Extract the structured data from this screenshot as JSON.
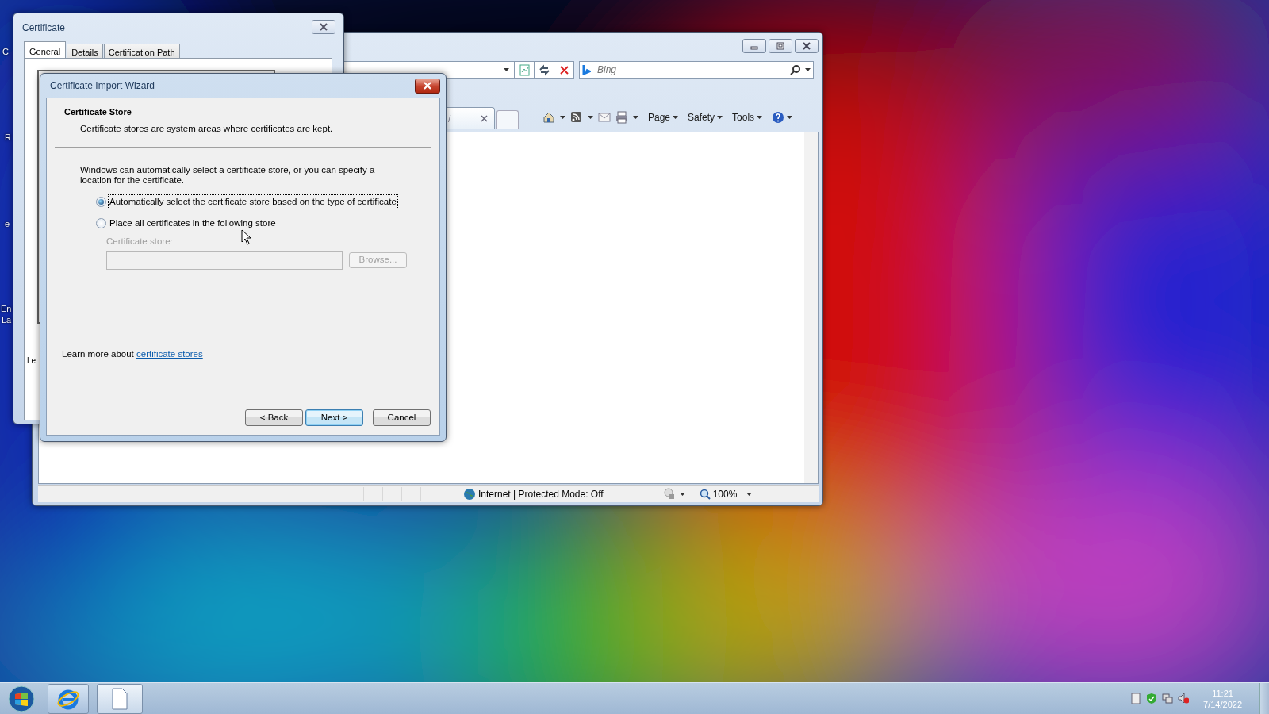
{
  "desktop": {
    "icon_labels": [
      {
        "text": "C"
      },
      {
        "text": "R"
      },
      {
        "text": "e"
      },
      {
        "text": "En"
      },
      {
        "text": "La"
      }
    ]
  },
  "browser": {
    "search": {
      "placeholder": "Bing"
    },
    "tab": {
      "title": "/"
    },
    "menus": [
      {
        "label": "Page"
      },
      {
        "label": "Safety"
      },
      {
        "label": "Tools"
      }
    ],
    "status": {
      "zone": "Internet | Protected Mode: Off",
      "zoom": "100%"
    }
  },
  "certificate_window": {
    "title": "Certificate",
    "tabs": [
      {
        "label": "General",
        "selected": true
      },
      {
        "label": "Details",
        "selected": false
      },
      {
        "label": "Certification Path",
        "selected": false
      }
    ],
    "panel_text": "Le"
  },
  "wizard": {
    "title": "Certificate Import Wizard",
    "header_title": "Certificate Store",
    "header_subtitle": "Certificate stores are system areas where certificates are kept.",
    "description": "Windows can automatically select a certificate store, or you can specify a location for the certificate.",
    "options": [
      {
        "label": "Automatically select the certificate store based on the type of certificate",
        "selected": true,
        "focused": true
      },
      {
        "label": "Place all certificates in the following store",
        "selected": false,
        "focused": false
      }
    ],
    "store_label": "Certificate store:",
    "store_field": {
      "disabled": true
    },
    "browse": {
      "label": "Browse...",
      "disabled": true
    },
    "learn_more": {
      "text": "Learn more about",
      "link": "certificate stores"
    },
    "buttons": [
      {
        "label": "< Back",
        "default": false
      },
      {
        "label": "Next >",
        "default": true
      },
      {
        "label": "Cancel",
        "default": false
      }
    ]
  },
  "taskbar": {
    "time": "11:21",
    "date": "7/14/2022"
  }
}
